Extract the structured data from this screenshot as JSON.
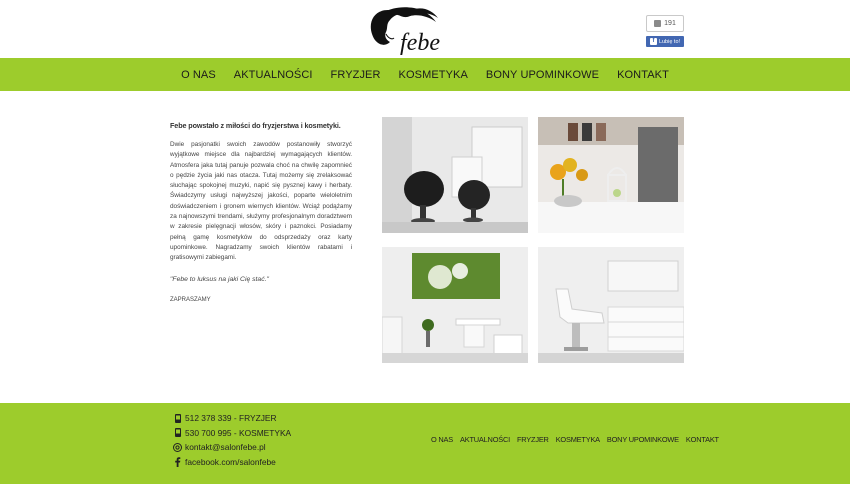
{
  "brand": {
    "logo_text": "febe"
  },
  "social": {
    "like_count": "191",
    "like_button": "Lubię to!"
  },
  "nav": {
    "items": [
      "O NAS",
      "AKTUALNOŚCI",
      "FRYZJER",
      "KOSMETYKA",
      "BONY UPOMINKOWE",
      "KONTAKT"
    ]
  },
  "about": {
    "intro": "Febe powstało z miłości do fryzjerstwa i kosmetyki.",
    "body": "Dwie pasjonatki swoich zawodów postanowiły stworzyć wyjątkowe miejsce dla najbardziej wymagających klientów. Atmosfera jaka tutaj panuje pozwala choć na chwilę zapomnieć o pędzie życia jaki nas otacza. Tutaj możemy się zrelaksować słuchając spokojnej muzyki, napić się pysznej kawy i herbaty. Świadczymy usługi najwyższej jakości, poparte wieloletnim doświadczeniem i gronem wiernych klientów. Wciąż podążamy za najnowszymi trendami, służymy profesjonalnym doradztwem w zakresie pielęgnacji włosów, skóry i paznokci. Posiadamy pełną gamę kosmetyków do odsprzedaży oraz karty upominkowe. Nagradzamy swoich klientów rabatami i gratisowymi zabiegami.",
    "quote": "\"Febe to luksus na jaki Cię stać.\"",
    "sign": "ZAPRASZAMY"
  },
  "footer": {
    "contacts": [
      {
        "icon": "phone-icon",
        "text": "512 378 339 - FRYZJER"
      },
      {
        "icon": "phone-icon",
        "text": "530 700 995 - KOSMETYKA"
      },
      {
        "icon": "at-icon",
        "text": "kontakt@salonfebe.pl"
      },
      {
        "icon": "facebook-icon",
        "text": "facebook.com/salonfebe"
      }
    ],
    "nav": [
      "O NAS",
      "AKTUALNOŚCI",
      "FRYZJER",
      "KOSMETYKA",
      "BONY UPOMINKOWE",
      "KONTAKT"
    ]
  },
  "colors": {
    "accent": "#9dcc2c",
    "header_bg": "#ffffff",
    "page_bg": "#f2f2f2"
  }
}
